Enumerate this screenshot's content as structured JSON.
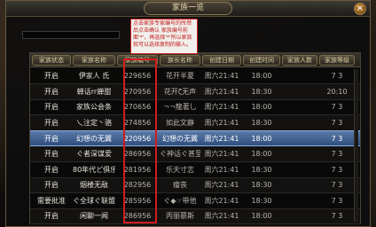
{
  "window": {
    "title": "家族一览",
    "close_label": "×"
  },
  "annotation": {
    "text": "点击家族专家编号的所然后点击确认 家族编号前面'*'，再选择'*'所以家族就可以选择复制的输入。"
  },
  "table": {
    "headers": [
      "家族状态",
      "家族名称",
      "家族编号",
      "族长名称",
      "创建日期",
      "创建时间",
      "家族人数",
      "家族等级"
    ],
    "rows": [
      [
        "开启",
        "伊家人 氏",
        "229656",
        "花开半夏",
        "周六21:41",
        "18:00",
        "",
        "7 3"
      ],
      [
        "开启",
        "蝉话rr蝉甜",
        "270956",
        "花开ζ无声",
        "周六21:41",
        "18:30",
        "",
        "20:10"
      ],
      [
        "开启",
        "家族公会条",
        "270656",
        "¬¬龍著乚",
        "周六21:41",
        "18:00",
        "",
        "7 3"
      ],
      [
        "开启",
        "乀注定丶骆",
        "274856",
        "如此文静",
        "周六21:41",
        "18:30",
        "",
        "7 3"
      ],
      [
        "开启",
        "幻想の无翼",
        "220956",
        "幻想の无翼",
        "周六21:41",
        "18:00",
        "",
        "7 3"
      ],
      [
        "开启",
        "ぐ者深谋爱",
        "286956",
        "ぐ神话ぐ甚至",
        "周六21:41",
        "18:00",
        "",
        "7 3"
      ],
      [
        "开启",
        "80年代ど俱乐",
        "281956",
        "乐天寸志",
        "周六21:41",
        "18:30",
        "",
        "7 3"
      ],
      [
        "开启",
        "烟楼无敌",
        "282956",
        "瘤丧",
        "周六21:41",
        "18:30",
        "",
        "7 3"
      ],
      [
        "需要批准",
        "ぐ全球ぐ联盟",
        "285956",
        "ぐ◆☞带他",
        "周六21:41",
        "18:30",
        "",
        "7 3"
      ],
      [
        "开启",
        "闲聊一闻",
        "286956",
        "丙丽慕斯",
        "周六21:41",
        "18:00",
        "",
        "7 3"
      ]
    ],
    "selected_row": 4
  }
}
